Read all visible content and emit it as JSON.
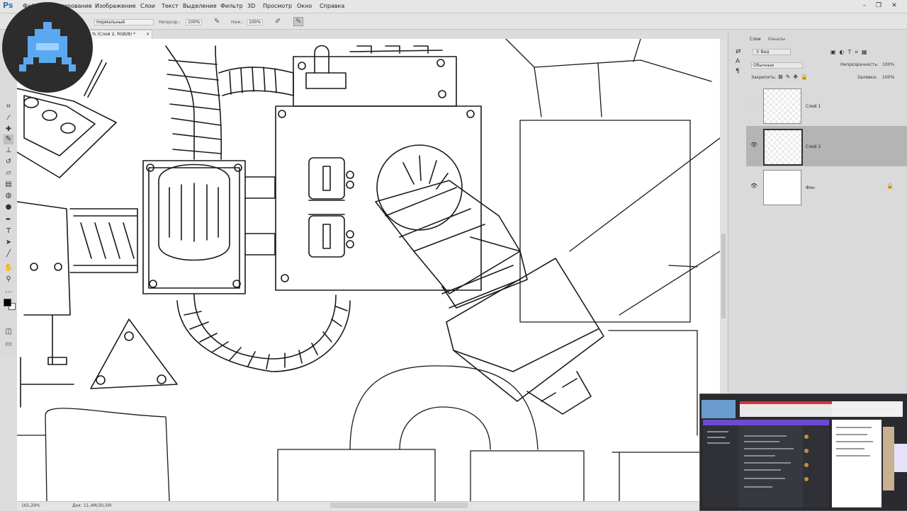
{
  "app": {
    "logo": "Ps"
  },
  "menu": [
    "Файл",
    "Редактирование",
    "Изображение",
    "Слои",
    "Текст",
    "Выделение",
    "Фильтр",
    "3D",
    "Просмотр",
    "Окно",
    "Справка"
  ],
  "options": {
    "mode_value": "Нормальный",
    "opacity_label": "Непрозр.:",
    "opacity_value": "100%",
    "pressure_label": "Наж.:",
    "pressure_value": "100%"
  },
  "document": {
    "tab_title": "% (Слой 2, RGB/8) *",
    "tab_close": "×"
  },
  "panel": {
    "tabs": [
      "Слои",
      "Каналы"
    ],
    "filter_kind": "Вид",
    "blend_mode": "Обычные",
    "opacity_label": "Непрозрачность:",
    "opacity_value": "100%",
    "lock_label": "Закрепить:",
    "fill_label": "Заливка:",
    "fill_value": "100%",
    "layers": [
      {
        "name": "Слой 1",
        "visible": false,
        "selected": false
      },
      {
        "name": "Слой 2",
        "visible": true,
        "selected": true
      },
      {
        "name": "Фон",
        "visible": true,
        "selected": false,
        "locked": true
      }
    ]
  },
  "status": {
    "zoom": "165,29%",
    "doc_size": "Док: 11,4M/30,5M"
  },
  "colors": {
    "accent_avatar": "#5aa9f0",
    "selected_layer": "#b4b4b4"
  },
  "icons": [
    "move-icon",
    "marquee-icon",
    "lasso-icon",
    "quick-select-icon",
    "crop-icon",
    "eyedropper-icon",
    "healing-icon",
    "brush-icon",
    "stamp-icon",
    "history-brush-icon",
    "eraser-icon",
    "gradient-icon",
    "blur-icon",
    "dodge-icon",
    "pen-icon",
    "type-icon",
    "path-select-icon",
    "shape-icon",
    "hand-icon",
    "zoom-icon"
  ]
}
